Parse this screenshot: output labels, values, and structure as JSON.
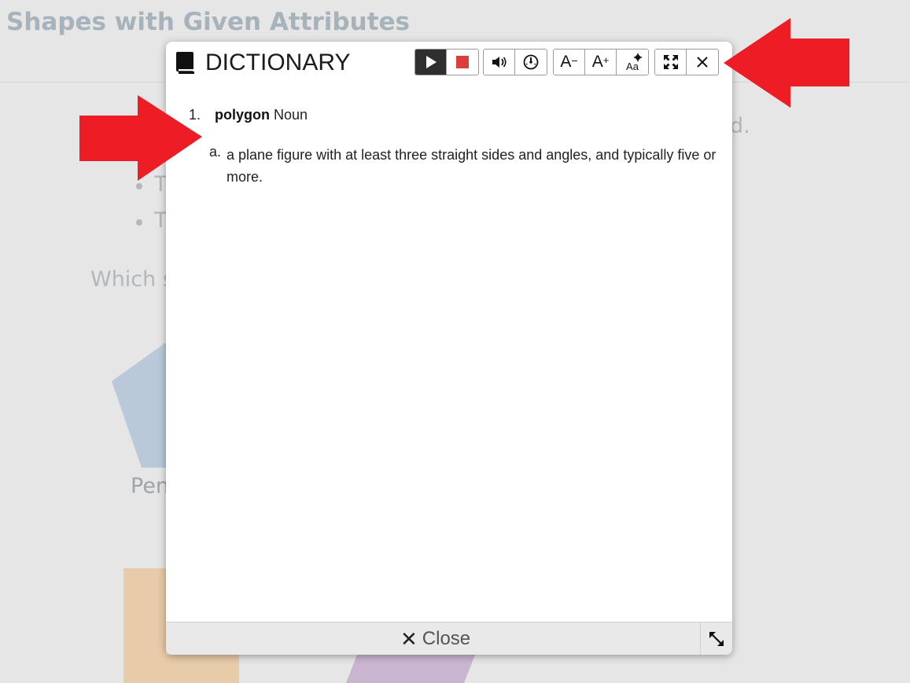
{
  "background": {
    "page_title": "Shapes with Given Attributes",
    "fragment_right": "d.",
    "bullet_1": "T",
    "bullet_2": "T",
    "question_fragment": "Which s",
    "shape_label_fragment": "Pen",
    "colors": {
      "pentagon": "#b9c9d9",
      "rectangle": "#e8cba8",
      "parallelogram": "#c9b5d0"
    }
  },
  "dialog": {
    "title": "DICTIONARY",
    "toolbar": {
      "play": {
        "icon": "play-icon"
      },
      "stop": {
        "icon": "stop-icon",
        "color": "#d9403a"
      },
      "volume": {
        "icon": "volume-icon"
      },
      "speed": {
        "icon": "speed-gauge-icon"
      },
      "font_smaller_label": "A",
      "font_larger_label": "A",
      "text_settings_label": "Aa",
      "fullscreen": {
        "icon": "fullscreen-icon"
      },
      "close": {
        "icon": "close-icon"
      }
    },
    "entry": {
      "number": "1.",
      "word": "polygon",
      "part_of_speech": "Noun",
      "definition_marker": "a.",
      "definition": "a plane figure with at least three straight sides and angles, and typically five or more."
    },
    "footer": {
      "close_label": "Close",
      "close_glyph": "✕"
    }
  },
  "annotations": {
    "arrow_color": "#ee1c25"
  }
}
